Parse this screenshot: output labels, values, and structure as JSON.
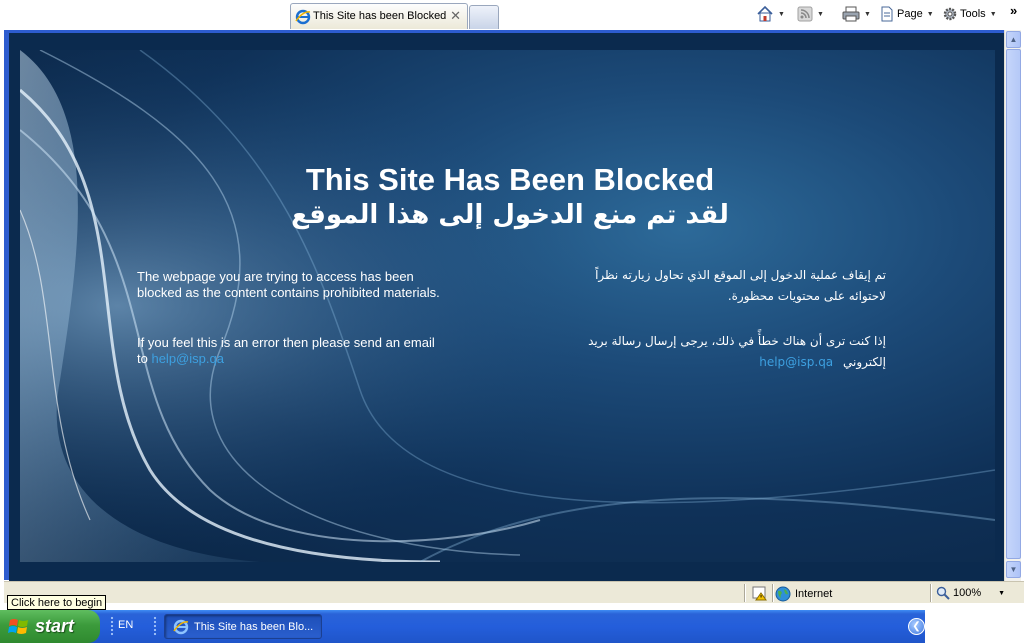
{
  "browser": {
    "tab_title": "This Site has been Blocked",
    "tab_close": "✕",
    "toolbar": {
      "page_label": "Page",
      "tools_label": "Tools",
      "overflow": "»"
    }
  },
  "page": {
    "title_en": "This Site Has Been Blocked",
    "title_ar": "لقد تم منع الدخول إلى هذا الموقع",
    "en_para1": "The webpage you are trying to access has been blocked as the content contains prohibited materials.",
    "en_para2_text": "If you feel this is an error then please send an email to ",
    "en_email": "help@isp.qa",
    "ar_para1": "تم إيقاف عملية الدخول إلى الموقع الذي تحاول زيارته نظراً لاحتوائه على محتويات محظورة.",
    "ar_para2_text": "إذا كنت ترى أن هناك خطأً في ذلك، يرجى إرسال رسالة بريد إلكتروني",
    "ar_email": "help@isp.qa"
  },
  "statusbar": {
    "zone": "Internet",
    "zoom": "100%",
    "tooltip": "Click here to begin"
  },
  "taskbar": {
    "start_label": "start",
    "language": "EN",
    "task_item": "This Site has been Blo..."
  },
  "colors": {
    "link": "#3da0e0",
    "banner_dark": "#0a2443",
    "banner_light": "#2d6a99",
    "taskbar_blue": "#245edb",
    "start_green": "#3c9b3c"
  }
}
